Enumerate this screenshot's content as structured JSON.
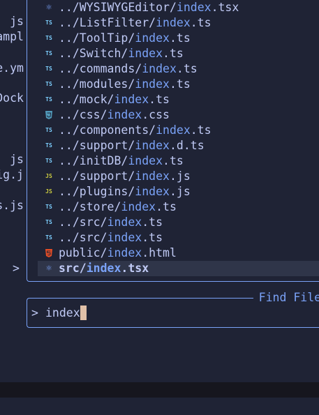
{
  "left_pane": {
    "fragments": [
      "js",
      "ampl",
      "e.ym",
      "Dock",
      "js",
      "ig.j",
      "s.js"
    ]
  },
  "results": [
    {
      "icon": "react",
      "pre": "../WYSIWYGEditor/",
      "match": "index",
      "post": ".tsx"
    },
    {
      "icon": "ts",
      "pre": "../ListFilter/",
      "match": "index",
      "post": ".ts"
    },
    {
      "icon": "ts",
      "pre": "../ToolTip/",
      "match": "index",
      "post": ".ts"
    },
    {
      "icon": "ts",
      "pre": "../Switch/",
      "match": "index",
      "post": ".ts"
    },
    {
      "icon": "ts",
      "pre": "../commands/",
      "match": "index",
      "post": ".ts"
    },
    {
      "icon": "ts",
      "pre": "../modules/",
      "match": "index",
      "post": ".ts"
    },
    {
      "icon": "ts",
      "pre": "../mock/",
      "match": "index",
      "post": ".ts"
    },
    {
      "icon": "css",
      "pre": "../css/",
      "match": "index",
      "post": ".css"
    },
    {
      "icon": "ts",
      "pre": "../components/",
      "match": "index",
      "post": ".ts"
    },
    {
      "icon": "ts",
      "pre": "../support/",
      "match": "index",
      "post": ".d.ts"
    },
    {
      "icon": "ts",
      "pre": "../initDB/",
      "match": "index",
      "post": ".ts"
    },
    {
      "icon": "js",
      "pre": "../support/",
      "match": "index",
      "post": ".js"
    },
    {
      "icon": "js",
      "pre": "../plugins/",
      "match": "index",
      "post": ".js"
    },
    {
      "icon": "ts",
      "pre": "../store/",
      "match": "index",
      "post": ".ts"
    },
    {
      "icon": "ts",
      "pre": "../src/",
      "match": "index",
      "post": ".ts"
    },
    {
      "icon": "ts",
      "pre": "../src/",
      "match": "index",
      "post": ".ts"
    },
    {
      "icon": "html",
      "pre": "public/",
      "match": "index",
      "post": ".html"
    },
    {
      "icon": "react",
      "pre": "src/",
      "match": "index",
      "post": ".tsx",
      "selected": true
    }
  ],
  "selection_caret": ">",
  "prompt": {
    "title": "Find Files",
    "prefix": ">",
    "value": "index"
  },
  "colors": {
    "background": "#1f2335",
    "border": "#7aa2f7",
    "match": "#7aa2f7",
    "selected_row": "#2f3549",
    "cursor": "#e0c0a8"
  }
}
